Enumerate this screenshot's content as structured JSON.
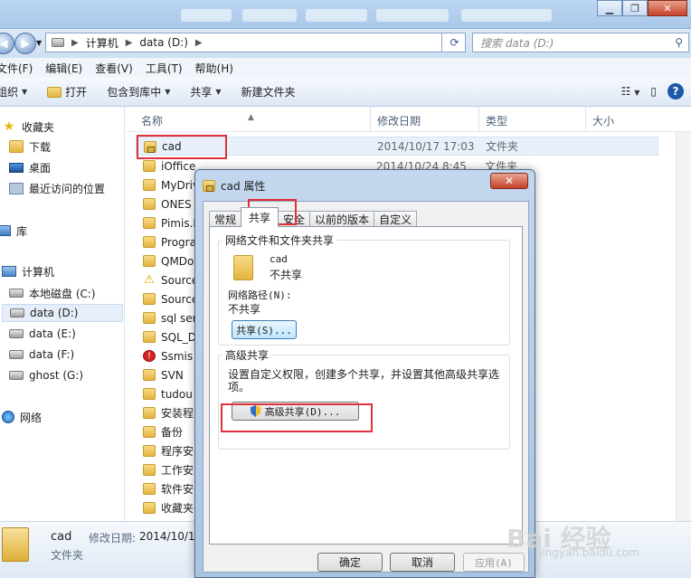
{
  "address": {
    "crumbs": [
      "计算机",
      "data (D:)"
    ],
    "search_placeholder": "搜索 data (D:)"
  },
  "menu": [
    "文件(F)",
    "编辑(E)",
    "查看(V)",
    "工具(T)",
    "帮助(H)"
  ],
  "toolbar": {
    "organize": "组织",
    "open": "打开",
    "include": "包含到库中",
    "share": "共享",
    "new_folder": "新建文件夹"
  },
  "nav": {
    "favorites": "收藏夹",
    "downloads": "下载",
    "desktop": "桌面",
    "recent": "最近访问的位置",
    "libraries": "库",
    "computer": "计算机",
    "drives": [
      "本地磁盘 (C:)",
      "data (D:)",
      "data (E:)",
      "data (F:)",
      "ghost (G:)"
    ],
    "network": "网络"
  },
  "columns": {
    "name": "名称",
    "date": "修改日期",
    "type": "类型",
    "size": "大小"
  },
  "files": [
    {
      "name": "cad",
      "date": "2014/10/17 17:03",
      "type": "文件夹",
      "icon": "lock-folder-icon"
    },
    {
      "name": "iOffice",
      "date": "2014/10/24 8:45",
      "type": "文件夹",
      "icon": "folder-icon"
    },
    {
      "name": "MyDriv",
      "icon": "folder-icon"
    },
    {
      "name": "ONES",
      "icon": "folder-icon"
    },
    {
      "name": "Pimis.E",
      "icon": "folder-icon"
    },
    {
      "name": "Progra",
      "icon": "folder-icon"
    },
    {
      "name": "QMDo",
      "icon": "folder-icon"
    },
    {
      "name": "Source",
      "icon": "warning-folder-icon"
    },
    {
      "name": "Source",
      "icon": "folder-icon"
    },
    {
      "name": "sql ser",
      "icon": "folder-icon"
    },
    {
      "name": "SQL_D",
      "icon": "folder-icon"
    },
    {
      "name": "Ssmis",
      "icon": "error-folder-icon"
    },
    {
      "name": "SVN",
      "icon": "folder-icon"
    },
    {
      "name": "tudou",
      "icon": "folder-icon"
    },
    {
      "name": "安装程",
      "icon": "folder-icon"
    },
    {
      "name": "备份",
      "icon": "folder-icon"
    },
    {
      "name": "程序安",
      "icon": "folder-icon"
    },
    {
      "name": "工作安",
      "icon": "folder-icon"
    },
    {
      "name": "软件安",
      "icon": "folder-icon"
    },
    {
      "name": "收藏夹",
      "icon": "folder-icon"
    }
  ],
  "details": {
    "name": "cad",
    "type": "文件夹",
    "date_label": "修改日期:",
    "date_value": "2014/10/1"
  },
  "dialog": {
    "title": "cad 属性",
    "close": "✕",
    "tabs": [
      "常规",
      "共享",
      "安全",
      "以前的版本",
      "自定义"
    ],
    "network_group": "网络文件和文件夹共享",
    "folder_name": "cad",
    "share_status": "不共享",
    "network_path_label": "网络路径(N):",
    "network_path_value": "不共享",
    "share_button": "共享(S)...",
    "advanced_group": "高级共享",
    "advanced_desc": "设置自定义权限，创建多个共享，并设置其他高级共享选项。",
    "advanced_button": "高级共享(D)...",
    "ok": "确定",
    "cancel": "取消",
    "apply": "应用(A)"
  },
  "watermark": {
    "brand": "Bai 经验",
    "url": "jingyan.baidu.com"
  },
  "colors": {
    "highlight": "#e0303a",
    "accent": "#1f5aa8"
  }
}
